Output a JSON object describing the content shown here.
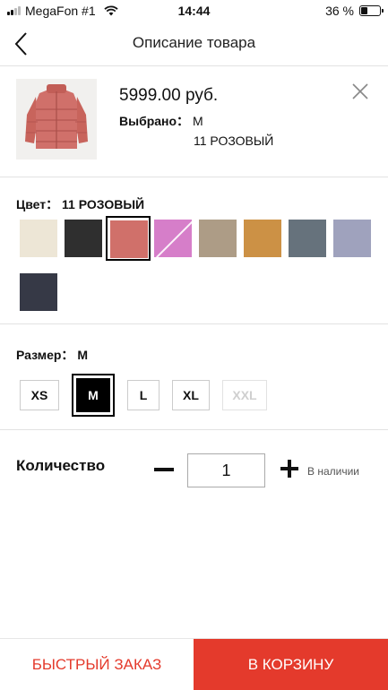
{
  "status_bar": {
    "carrier": "MegaFon #1",
    "time": "14:44",
    "battery": "36 %",
    "battery_level": 0.36
  },
  "nav": {
    "title": "Описание товара",
    "back_icon": "chevron-left-icon"
  },
  "product": {
    "price": "5999.00 руб.",
    "selected_label": "Выбрано：",
    "selected_size": "M",
    "selected_color": "11 РОЗОВЫЙ",
    "close_icon": "close-icon"
  },
  "color": {
    "label": "Цвет：",
    "value": "11 РОЗОВЫЙ",
    "swatches": [
      {
        "color": "#ede6d6",
        "selected": false,
        "crossed": false
      },
      {
        "color": "#2f2f2f",
        "selected": false,
        "crossed": false
      },
      {
        "color": "#d0706a",
        "selected": true,
        "crossed": false
      },
      {
        "color": "#d67ec9",
        "selected": false,
        "crossed": true
      },
      {
        "color": "#ad9c86",
        "selected": false,
        "crossed": false
      },
      {
        "color": "#cc9145",
        "selected": false,
        "crossed": false
      },
      {
        "color": "#66727c",
        "selected": false,
        "crossed": false
      },
      {
        "color": "#9fa2bd",
        "selected": false,
        "crossed": false
      },
      {
        "color": "#363946",
        "selected": false,
        "crossed": false
      }
    ]
  },
  "size": {
    "label": "Размер：",
    "value": "M",
    "options": [
      {
        "label": "XS",
        "state": "available"
      },
      {
        "label": "M",
        "state": "selected"
      },
      {
        "label": "L",
        "state": "available"
      },
      {
        "label": "XL",
        "state": "available"
      },
      {
        "label": "XXL",
        "state": "disabled"
      }
    ]
  },
  "quantity": {
    "label": "Количество",
    "value": "1",
    "stock": "В наличии"
  },
  "actions": {
    "quick_order": "БЫСТРЫЙ ЗАКАЗ",
    "to_cart": "В КОРЗИНУ"
  },
  "colors": {
    "accent": "#e43a2c",
    "divider": "#e2e2e2"
  }
}
